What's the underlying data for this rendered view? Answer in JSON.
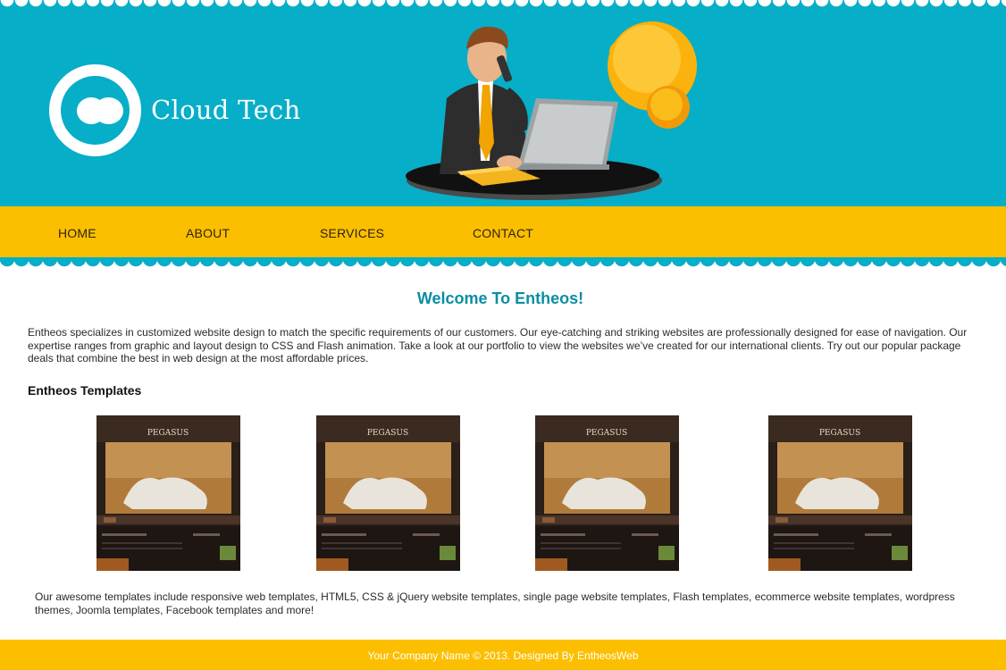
{
  "header": {
    "brand_name": "Cloud Tech",
    "logo_icon": "cloud-icon",
    "illustration": "businessman-laptop-phone-illustration",
    "colors": {
      "header_bg": "#07aec8",
      "nav_bg": "#fcbf00",
      "title_accent": "#0a8ea3"
    }
  },
  "nav": {
    "items": [
      {
        "label": "HOME"
      },
      {
        "label": "ABOUT"
      },
      {
        "label": "SERVICES"
      },
      {
        "label": "CONTACT"
      }
    ]
  },
  "main": {
    "welcome_title": "Welcome To Entheos!",
    "intro": "Entheos specializes in customized website design to match the specific requirements of our customers. Our eye-catching and striking websites are professionally designed for ease of navigation. Our expertise ranges from graphic and layout design to CSS and Flash animation. Take a look at our portfolio to view the websites we’ve created for our international clients. Try out our popular package deals that combine the best in web design at the most affordable prices.",
    "templates_heading": "Entheos Templates",
    "templates": [
      {
        "title": "PEGASUS"
      },
      {
        "title": "PEGASUS"
      },
      {
        "title": "PEGASUS"
      },
      {
        "title": "PEGASUS"
      }
    ],
    "outro": "Our awesome templates include responsive web templates, HTML5, CSS & jQuery website templates, single page website templates, Flash templates, ecommerce website templates, wordpress themes, Joomla templates, Facebook templates and more!"
  },
  "footer": {
    "text": "Your Company Name © 2013. Designed By EntheosWeb"
  }
}
